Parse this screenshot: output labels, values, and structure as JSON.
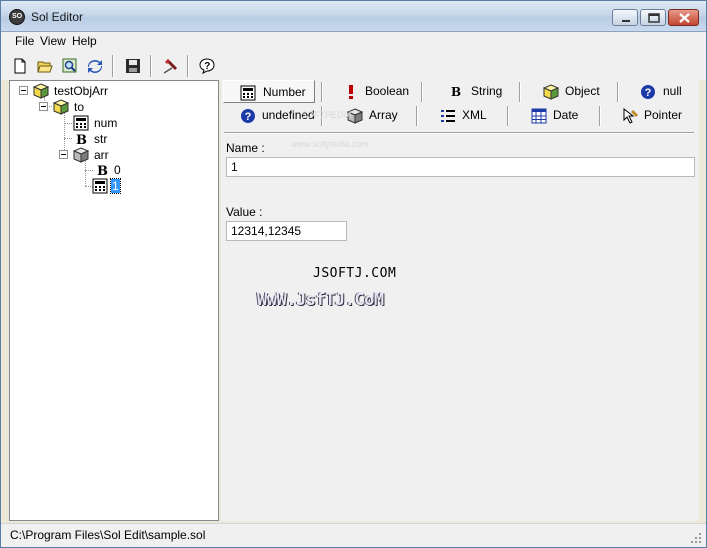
{
  "window": {
    "title": "Sol Editor",
    "icon_text": "SO"
  },
  "menu": [
    {
      "label": "File"
    },
    {
      "label": "View"
    },
    {
      "label": "Help"
    }
  ],
  "toolbar": {
    "buttons": [
      "new-file-icon",
      "open-folder-icon",
      "search-icon",
      "refresh-icon",
      "save-icon",
      "pin-icon",
      "help-icon"
    ]
  },
  "tree": {
    "root": "testObjArr",
    "to": "to",
    "num": "num",
    "str": "str",
    "arr": "arr",
    "arr_item_0": "0",
    "arr_item_1": "1"
  },
  "types": {
    "number": "Number",
    "boolean": "Boolean",
    "string": "String",
    "object": "Object",
    "null": "null",
    "undefined": "undefined",
    "array": "Array",
    "xml": "XML",
    "date": "Date",
    "pointer": "Pointer"
  },
  "editor": {
    "name_label": "Name :",
    "name_value": "1",
    "value_label": "Value :",
    "value_value": "12314,12345"
  },
  "watermarks": {
    "site": "JSOFTJ.COM",
    "art": "WwW.JsfTJ.CoM",
    "faded_1": "SOFTPEDIA",
    "faded_2": "www.softpedia.com"
  },
  "status": {
    "path": "C:\\Program Files\\Sol Edit\\sample.sol"
  }
}
